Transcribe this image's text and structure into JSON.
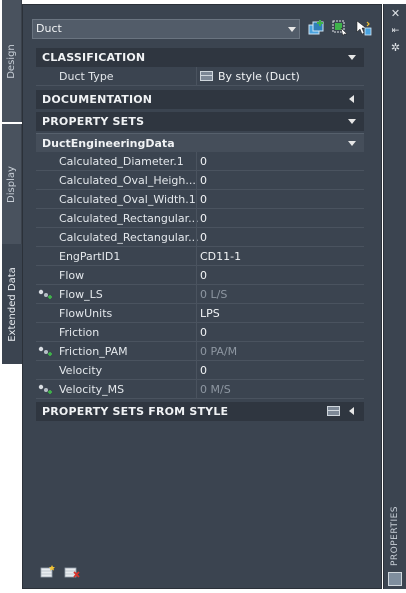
{
  "left_tabs": [
    {
      "label": "Design"
    },
    {
      "label": "Display"
    },
    {
      "label": "Extended Data",
      "active": true
    }
  ],
  "object_select": {
    "value": "Duct"
  },
  "toolbar": {
    "icons": [
      "add-object-icon",
      "quick-select-icon",
      "toggle-pickadd-icon"
    ]
  },
  "sections": {
    "classification": {
      "label": "CLASSIFICATION",
      "expanded": true
    },
    "documentation": {
      "label": "DOCUMENTATION",
      "expanded": false
    },
    "property_sets": {
      "label": "PROPERTY SETS",
      "expanded": true
    },
    "property_sets_from_style": {
      "label": "PROPERTY SETS FROM STYLE",
      "expanded": false
    }
  },
  "classification_rows": [
    {
      "name": "Duct Type",
      "value": "By style (Duct)"
    }
  ],
  "property_set": {
    "name": "DuctEngineeringData",
    "rows": [
      {
        "name": "Calculated_Diameter.1",
        "value": "0",
        "auto": false,
        "dim": false
      },
      {
        "name": "Calculated_Oval_Heigh...",
        "value": "0",
        "auto": false,
        "dim": false
      },
      {
        "name": "Calculated_Oval_Width.1",
        "value": "0",
        "auto": false,
        "dim": false
      },
      {
        "name": "Calculated_Rectangular...",
        "value": "0",
        "auto": false,
        "dim": false
      },
      {
        "name": "Calculated_Rectangular...",
        "value": "0",
        "auto": false,
        "dim": false
      },
      {
        "name": "EngPartID1",
        "value": "CD11-1",
        "auto": false,
        "dim": false
      },
      {
        "name": "Flow",
        "value": "0",
        "auto": false,
        "dim": false
      },
      {
        "name": "Flow_LS",
        "value": "0 L/S",
        "auto": true,
        "dim": true
      },
      {
        "name": "FlowUnits",
        "value": "LPS",
        "auto": false,
        "dim": false
      },
      {
        "name": "Friction",
        "value": "0",
        "auto": false,
        "dim": false
      },
      {
        "name": "Friction_PAM",
        "value": "0 PA/M",
        "auto": true,
        "dim": true
      },
      {
        "name": "Velocity",
        "value": "0",
        "auto": false,
        "dim": false
      },
      {
        "name": "Velocity_MS",
        "value": "0 M/S",
        "auto": true,
        "dim": true
      }
    ]
  },
  "palette": {
    "title": "PROPERTIES"
  },
  "colors": {
    "panel_bg": "#3b4450",
    "header_bg": "#2f3640",
    "accent_green": "#3fb24a",
    "accent_blue": "#4aa3df"
  }
}
